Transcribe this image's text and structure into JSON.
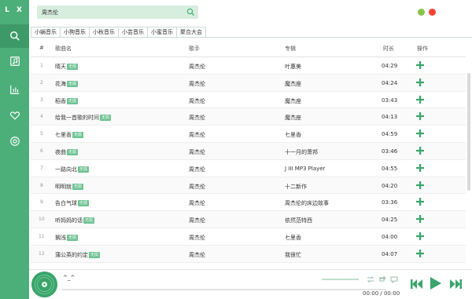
{
  "app": {
    "logo": "L X",
    "accent": "#4caf7a",
    "accent_dark": "#3d9a68",
    "light_accent": "#d7eedf"
  },
  "sidebar": {
    "items": [
      {
        "icon": "search-icon",
        "active": true
      },
      {
        "icon": "music-note-icon",
        "active": false
      },
      {
        "icon": "chart-icon",
        "active": false
      },
      {
        "icon": "heart-icon",
        "active": false
      },
      {
        "icon": "settings-icon",
        "active": false
      }
    ]
  },
  "search": {
    "value": "周杰伦",
    "icon": "search-icon"
  },
  "window": {
    "minimize_color": "#8bc34a",
    "close_color": "#f44336"
  },
  "tabs": [
    {
      "label": "小蜗音乐",
      "active": false
    },
    {
      "label": "小狗音乐",
      "active": true
    },
    {
      "label": "小秋音乐",
      "active": false
    },
    {
      "label": "小芸音乐",
      "active": false
    },
    {
      "label": "小蜜音乐",
      "active": false
    },
    {
      "label": "聚合大会",
      "active": false
    }
  ],
  "table": {
    "headers": {
      "index": "#",
      "name": "歌曲名",
      "artist": "歌手",
      "album": "专辑",
      "duration": "时长",
      "action": "操作"
    },
    "rows": [
      {
        "index": "1",
        "name": "晴天",
        "tag": "无损",
        "artist": "周杰伦",
        "album": "叶惠美",
        "duration": "04:29"
      },
      {
        "index": "2",
        "name": "花海",
        "tag": "无损",
        "artist": "周杰伦",
        "album": "魔杰座",
        "duration": "04:24"
      },
      {
        "index": "3",
        "name": "稻香",
        "tag": "无损",
        "artist": "周杰伦",
        "album": "魔杰座",
        "duration": "03:43"
      },
      {
        "index": "4",
        "name": "给我一首歌的时间",
        "tag": "无损",
        "artist": "周杰伦",
        "album": "魔杰座",
        "duration": "04:13"
      },
      {
        "index": "5",
        "name": "七里香",
        "tag": "无损",
        "artist": "周杰伦",
        "album": "七里香",
        "duration": "04:59"
      },
      {
        "index": "6",
        "name": "夜曲",
        "tag": "无损",
        "artist": "周杰伦",
        "album": "十一月的萧邦",
        "duration": "03:46"
      },
      {
        "index": "7",
        "name": "一路向北",
        "tag": "无损",
        "artist": "周杰伦",
        "album": "J III MP3 Player",
        "duration": "04:55"
      },
      {
        "index": "8",
        "name": "明明就",
        "tag": "无损",
        "artist": "周杰伦",
        "album": "十二新作",
        "duration": "04:20"
      },
      {
        "index": "9",
        "name": "告白气球",
        "tag": "无损",
        "artist": "周杰伦",
        "album": "周杰伦的床边故事",
        "duration": "03:36"
      },
      {
        "index": "10",
        "name": "听妈妈的话",
        "tag": "无损",
        "artist": "周杰伦",
        "album": "依然范特西",
        "duration": "04:25"
      },
      {
        "index": "11",
        "name": "搁浅",
        "tag": "无损",
        "artist": "周杰伦",
        "album": "七里香",
        "duration": "04:00"
      },
      {
        "index": "12",
        "name": "蒲公英的约定",
        "tag": "无损",
        "artist": "周杰伦",
        "album": "我很忙",
        "duration": "04:07"
      }
    ]
  },
  "player": {
    "title": "^_^",
    "time": "00:00 / 00:00",
    "icons": [
      "disc-icon",
      "repeat-icon",
      "shuffle-icon",
      "lyrics-icon",
      "prev-icon",
      "play-icon",
      "next-icon"
    ]
  }
}
